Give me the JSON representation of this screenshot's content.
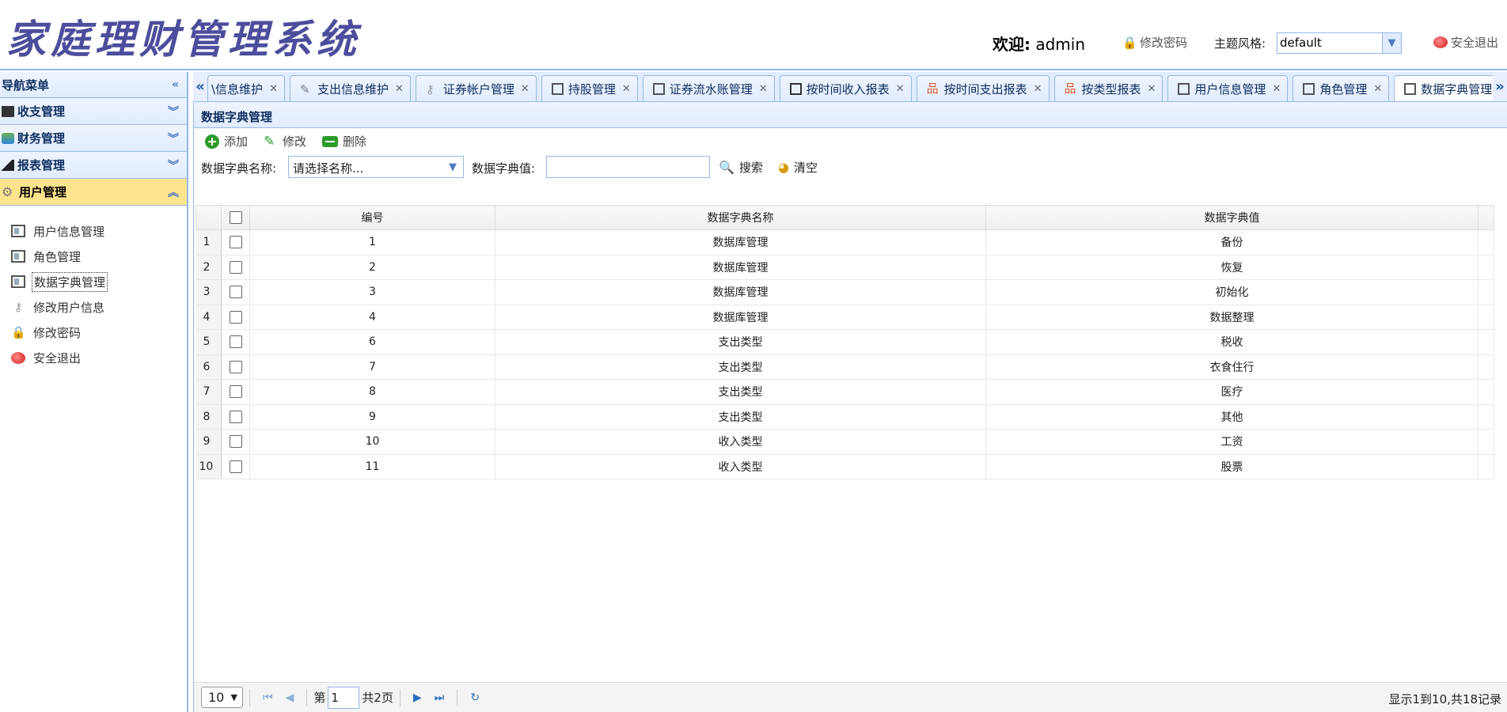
{
  "header": {
    "logo_text": "家庭理财管理系统",
    "welcome_prefix": "欢迎:",
    "username": "admin",
    "change_password": "修改密码",
    "theme_label": "主题风格:",
    "theme_value": "default",
    "logout": "安全退出"
  },
  "sidebar": {
    "title": "导航菜单",
    "groups": [
      {
        "label": "收支管理",
        "icon": "money-icon"
      },
      {
        "label": "财务管理",
        "icon": "finance-icon"
      },
      {
        "label": "报表管理",
        "icon": "chart-icon"
      },
      {
        "label": "用户管理",
        "icon": "gear-icon"
      }
    ],
    "items": [
      {
        "label": "用户信息管理",
        "icon": "doc-icon"
      },
      {
        "label": "角色管理",
        "icon": "doc-icon"
      },
      {
        "label": "数据字典管理",
        "icon": "doc-icon"
      },
      {
        "label": "修改用户信息",
        "icon": "key-icon"
      },
      {
        "label": "修改密码",
        "icon": "lock-icon"
      },
      {
        "label": "安全退出",
        "icon": "logout-icon"
      }
    ]
  },
  "tabs": [
    {
      "label": "\\信息维护",
      "icon": "none"
    },
    {
      "label": "支出信息维护",
      "icon": "edit-icon"
    },
    {
      "label": "证券帐户管理",
      "icon": "key-icon"
    },
    {
      "label": "持股管理",
      "icon": "stock-icon"
    },
    {
      "label": "证券流水账管理",
      "icon": "stock-icon"
    },
    {
      "label": "按时间收入报表",
      "icon": "report-icon"
    },
    {
      "label": "按时间支出报表",
      "icon": "org-icon"
    },
    {
      "label": "按类型报表",
      "icon": "org-icon"
    },
    {
      "label": "用户信息管理",
      "icon": "doc-icon"
    },
    {
      "label": "角色管理",
      "icon": "doc-icon"
    },
    {
      "label": "数据字典管理",
      "icon": "doc-icon"
    }
  ],
  "panel": {
    "title": "数据字典管理",
    "toolbar": {
      "add": "添加",
      "edit": "修改",
      "delete": "删除"
    },
    "search": {
      "name_label": "数据字典名称:",
      "name_placeholder": "请选择名称...",
      "value_label": "数据字典值:",
      "search_btn": "搜索",
      "clear_btn": "清空"
    },
    "columns": [
      "编号",
      "数据字典名称",
      "数据字典值"
    ],
    "rows": [
      {
        "rn": "1",
        "id": "1",
        "name": "数据库管理",
        "value": "备份"
      },
      {
        "rn": "2",
        "id": "2",
        "name": "数据库管理",
        "value": "恢复"
      },
      {
        "rn": "3",
        "id": "3",
        "name": "数据库管理",
        "value": "初始化"
      },
      {
        "rn": "4",
        "id": "4",
        "name": "数据库管理",
        "value": "数据整理"
      },
      {
        "rn": "5",
        "id": "6",
        "name": "支出类型",
        "value": "税收"
      },
      {
        "rn": "6",
        "id": "7",
        "name": "支出类型",
        "value": "衣食住行"
      },
      {
        "rn": "7",
        "id": "8",
        "name": "支出类型",
        "value": "医疗"
      },
      {
        "rn": "8",
        "id": "9",
        "name": "支出类型",
        "value": "其他"
      },
      {
        "rn": "9",
        "id": "10",
        "name": "收入类型",
        "value": "工资"
      },
      {
        "rn": "10",
        "id": "11",
        "name": "收入类型",
        "value": "股票"
      }
    ],
    "pager": {
      "page_size": "10",
      "page_prefix": "第",
      "current_page": "1",
      "total_pages": "共2页",
      "info": "显示1到10,共18记录"
    }
  },
  "colors": {
    "accent": "#95b8e7",
    "header_bg": "#e0ecff",
    "active_group": "#ffe48d",
    "logo": "#4c4d9c"
  }
}
